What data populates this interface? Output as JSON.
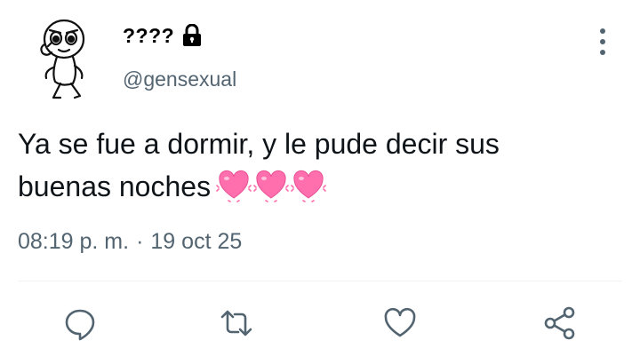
{
  "user": {
    "display_name": "????",
    "handle": "@gensexual",
    "avatar_icon": "meme-character-avatar",
    "protected_icon": "lock-icon"
  },
  "tweet": {
    "text_line1": "Ya se fue a dormir, y le pude decir sus",
    "text_line2": "buenas noches",
    "emojis": [
      "vibrating-heart-emoji",
      "vibrating-heart-emoji",
      "vibrating-heart-emoji"
    ],
    "time": "08:19 p. m.",
    "separator": "·",
    "date": "19 oct 25"
  },
  "actions": {
    "reply": "reply-icon",
    "retweet": "retweet-icon",
    "like": "heart-icon",
    "share": "share-icon"
  },
  "colors": {
    "text": "#0f1419",
    "secondary": "#536471",
    "divider": "#eff3f4",
    "heart_pink": "#ff6fae"
  }
}
